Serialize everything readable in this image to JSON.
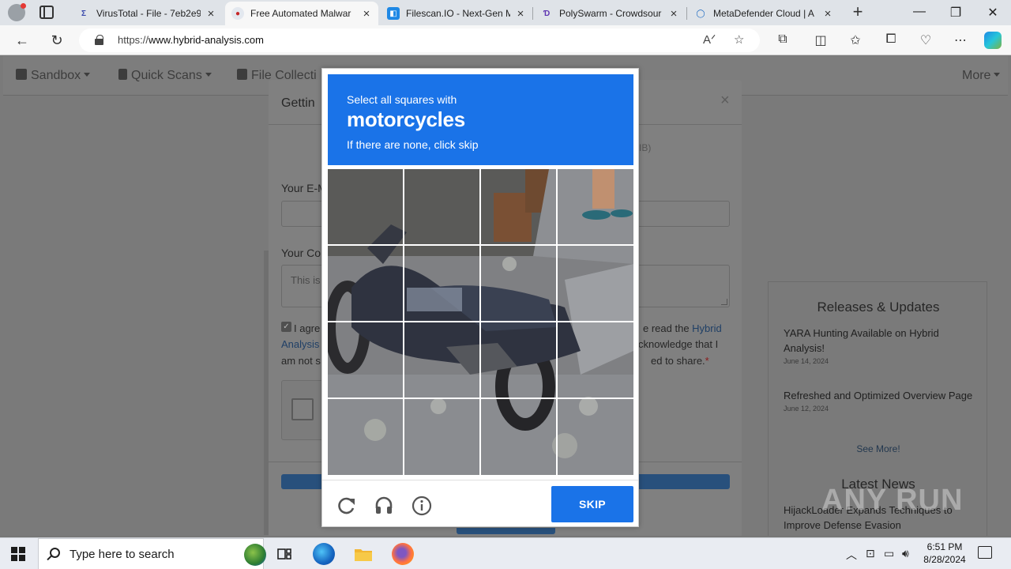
{
  "browser": {
    "tabs": [
      {
        "title": "VirusTotal - File - 7eb2e9",
        "close": "×",
        "fav": "Σ",
        "favcolor": "#3949ab",
        "active": false
      },
      {
        "title": "Free Automated Malwar",
        "close": "×",
        "fav": "●",
        "favcolor": "#c62828",
        "active": true
      },
      {
        "title": "Filescan.IO - Next-Gen M",
        "close": "×",
        "fav": "◧",
        "favcolor": "#1e88e5",
        "active": false
      },
      {
        "title": "PolySwarm - Crowdsour",
        "close": "×",
        "fav": "Ɗ",
        "favcolor": "#5e35b1",
        "active": false
      },
      {
        "title": "MetaDefender Cloud | A",
        "close": "×",
        "fav": "◯",
        "favcolor": "#1565c0",
        "active": false
      }
    ],
    "new_tab": "+",
    "url_prefix": "https://",
    "url_host": "www.hybrid-analysis.com",
    "window_controls": {
      "minimize": "—",
      "maximize": "❐",
      "close": "✕"
    }
  },
  "site_nav": {
    "items": [
      "Sandbox",
      "Quick Scans",
      "File Collecti"
    ],
    "more": "More"
  },
  "modal": {
    "title": "Gettin",
    "faint_text": "IB)",
    "email_label": "Your E-M",
    "comment_label": "Your Co",
    "comment_placeholder": "This is",
    "agree_left": [
      "I agre",
      "Analysis",
      "am not s"
    ],
    "agree_link_left": "Analysis",
    "agree_right_1": "e read the ",
    "agree_link_right": "Hybrid",
    "agree_right_2": "cknowledge that I",
    "agree_right_3": "ed to share.",
    "required_mark": "*",
    "close": "×"
  },
  "captcha": {
    "instruction": "Select all squares with",
    "target": "motorcycles",
    "hint": "If there are none, click skip",
    "skip_label": "SKIP",
    "icons": [
      "reload-icon",
      "audio-icon",
      "info-icon"
    ]
  },
  "sidebar": {
    "releases_title": "Releases & Updates",
    "releases": [
      {
        "title": "YARA Hunting Available on Hybrid Analysis!",
        "date": "June 14, 2024"
      },
      {
        "title": "Refreshed and Optimized Overview Page",
        "date": "June 12, 2024"
      }
    ],
    "see_more": "See More!",
    "news_title": "Latest News",
    "news": [
      {
        "title": "HijackLoader Expands Techniques to Improve Defense Evasion"
      }
    ]
  },
  "watermark": "ANY RUN",
  "taskbar": {
    "search_placeholder": "Type here to search",
    "time": "6:51 PM",
    "date": "8/28/2024"
  },
  "colors": {
    "captcha_blue": "#1a73e8",
    "site_blue": "#28507c"
  }
}
